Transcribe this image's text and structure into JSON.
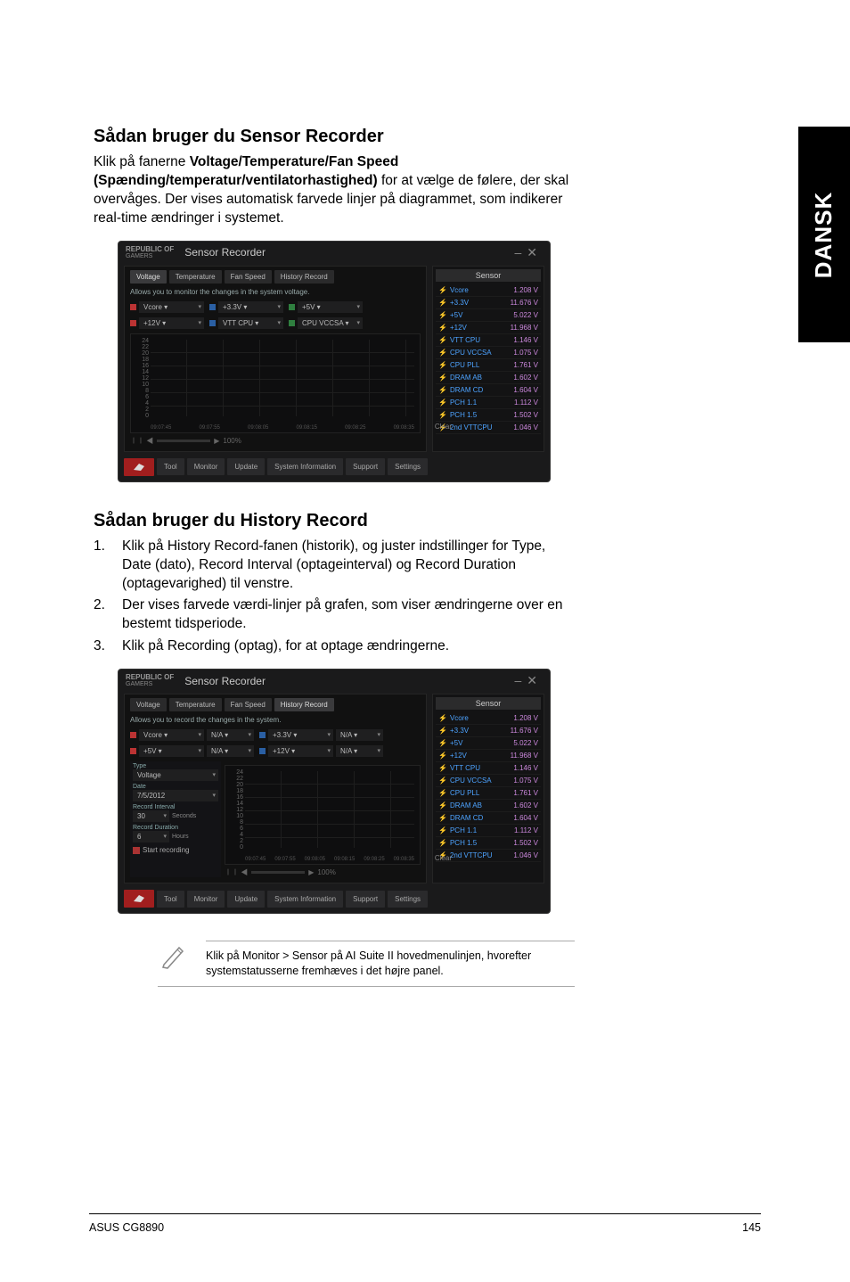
{
  "sideTab": "DANSK",
  "section1": {
    "heading": "Sådan bruger du Sensor Recorder",
    "paragraphPrefix": "Klik på fanerne ",
    "paragraphBold": "Voltage/Temperature/Fan Speed (Spænding/temperatur/ventilatorhastighed)",
    "paragraphSuffix": " for at vælge de følere, der skal overvåges. Der vises automatisk farvede linjer på diagrammet, som indikerer real-time ændringer i systemet."
  },
  "app": {
    "brand1": "REPUBLIC OF",
    "brand2": "GAMERS",
    "title": "Sensor Recorder",
    "winMin": "–",
    "winClose": "✕",
    "tabs": {
      "voltage": "Voltage",
      "temperature": "Temperature",
      "fanSpeed": "Fan Speed",
      "history": "History Record"
    },
    "hint1": "Allows you to monitor the changes in the system voltage.",
    "hint2": "Allows you to record the changes in the system.",
    "drops1": [
      {
        "color": "red",
        "label": "Vcore ▾"
      },
      {
        "color": "blue",
        "label": "+3.3V ▾"
      },
      {
        "color": "green",
        "label": "+5V ▾"
      }
    ],
    "drops1b": [
      {
        "color": "red",
        "label": "+12V ▾"
      },
      {
        "color": "blue",
        "label": "VTT CPU ▾"
      },
      {
        "color": "green",
        "label": "CPU VCCSA ▾"
      }
    ],
    "drops2a": [
      {
        "color": "red",
        "label": "Vcore ▾",
        "na": "N/A ▾"
      },
      {
        "color": "blue",
        "label": "+3.3V ▾",
        "na": "N/A ▾"
      }
    ],
    "drops2b": [
      {
        "color": "red",
        "label": "+5V ▾",
        "na": "N/A ▾"
      },
      {
        "color": "blue",
        "label": "+12V ▾",
        "na": "N/A ▾"
      }
    ],
    "yTicks": [
      "24",
      "22",
      "20",
      "18",
      "16",
      "14",
      "12",
      "10",
      "8",
      "6",
      "4",
      "2",
      "0"
    ],
    "xTicks": [
      "09:07:45",
      "09:07:55",
      "09:08:05",
      "09:08:15",
      "09:08:25",
      "09:08:35"
    ],
    "clear": "Clear",
    "zoomLabel": "100%",
    "sensorHead": "Sensor",
    "sensors": [
      {
        "name": "Vcore",
        "val": "1.208 V"
      },
      {
        "name": "+3.3V",
        "val": "11.676 V"
      },
      {
        "name": "+5V",
        "val": "5.022 V"
      },
      {
        "name": "+12V",
        "val": "11.968 V"
      },
      {
        "name": "VTT CPU",
        "val": "1.146 V"
      },
      {
        "name": "CPU VCCSA",
        "val": "1.075 V"
      },
      {
        "name": "CPU PLL",
        "val": "1.761 V"
      },
      {
        "name": "DRAM AB",
        "val": "1.602 V"
      },
      {
        "name": "DRAM CD",
        "val": "1.604 V"
      },
      {
        "name": "PCH 1.1",
        "val": "1.112 V"
      },
      {
        "name": "PCH 1.5",
        "val": "1.502 V"
      },
      {
        "name": "2nd VTTCPU",
        "val": "1.046 V"
      }
    ],
    "sensors2": [
      {
        "name": "Vcore",
        "val": "1.208 V"
      },
      {
        "name": "+3.3V",
        "val": "11.676 V"
      },
      {
        "name": "+5V",
        "val": "5.022 V"
      },
      {
        "name": "+12V",
        "val": "11.968 V"
      },
      {
        "name": "VTT CPU",
        "val": "1.146 V"
      },
      {
        "name": "CPU VCCSA",
        "val": "1.075 V"
      },
      {
        "name": "CPU PLL",
        "val": "1.761 V"
      },
      {
        "name": "DRAM AB",
        "val": "1.602 V"
      },
      {
        "name": "DRAM CD",
        "val": "1.604 V"
      },
      {
        "name": "PCH 1.1",
        "val": "1.112 V"
      },
      {
        "name": "PCH 1.5",
        "val": "1.502 V"
      },
      {
        "name": "2nd VTTCPU",
        "val": "1.046 V"
      }
    ],
    "settings": {
      "typeLabel": "Type",
      "type": "Voltage",
      "dateLabel": "Date",
      "date": "7/5/2012",
      "intLabel": "Record Interval",
      "interval": "30",
      "intUnit": "Seconds",
      "durLabel": "Record Duration",
      "duration": "6",
      "durUnit": "Hours",
      "startLabel": "Start recording"
    },
    "toolbar": {
      "tool": "Tool",
      "monitor": "Monitor",
      "update": "Update",
      "sysinfo": "System Information",
      "support": "Support",
      "settings": "Settings"
    }
  },
  "section2": {
    "heading": "Sådan bruger du History Record",
    "items": [
      {
        "n": "1.",
        "t": "Klik på History Record-fanen (historik), og juster indstillinger for Type, Date (dato), Record Interval (optageinterval) og Record Duration (optagevarighed) til venstre."
      },
      {
        "n": "2.",
        "t": "Der vises farvede værdi-linjer på grafen, som viser ændringerne over en bestemt tidsperiode."
      },
      {
        "n": "3.",
        "t": "Klik på Recording (optag), for at optage ændringerne."
      }
    ]
  },
  "note": "Klik på Monitor > Sensor på AI Suite II hovedmenulinjen, hvorefter systemstatusserne fremhæves i det højre panel.",
  "footer": {
    "left": "ASUS CG8890",
    "page": "145"
  }
}
